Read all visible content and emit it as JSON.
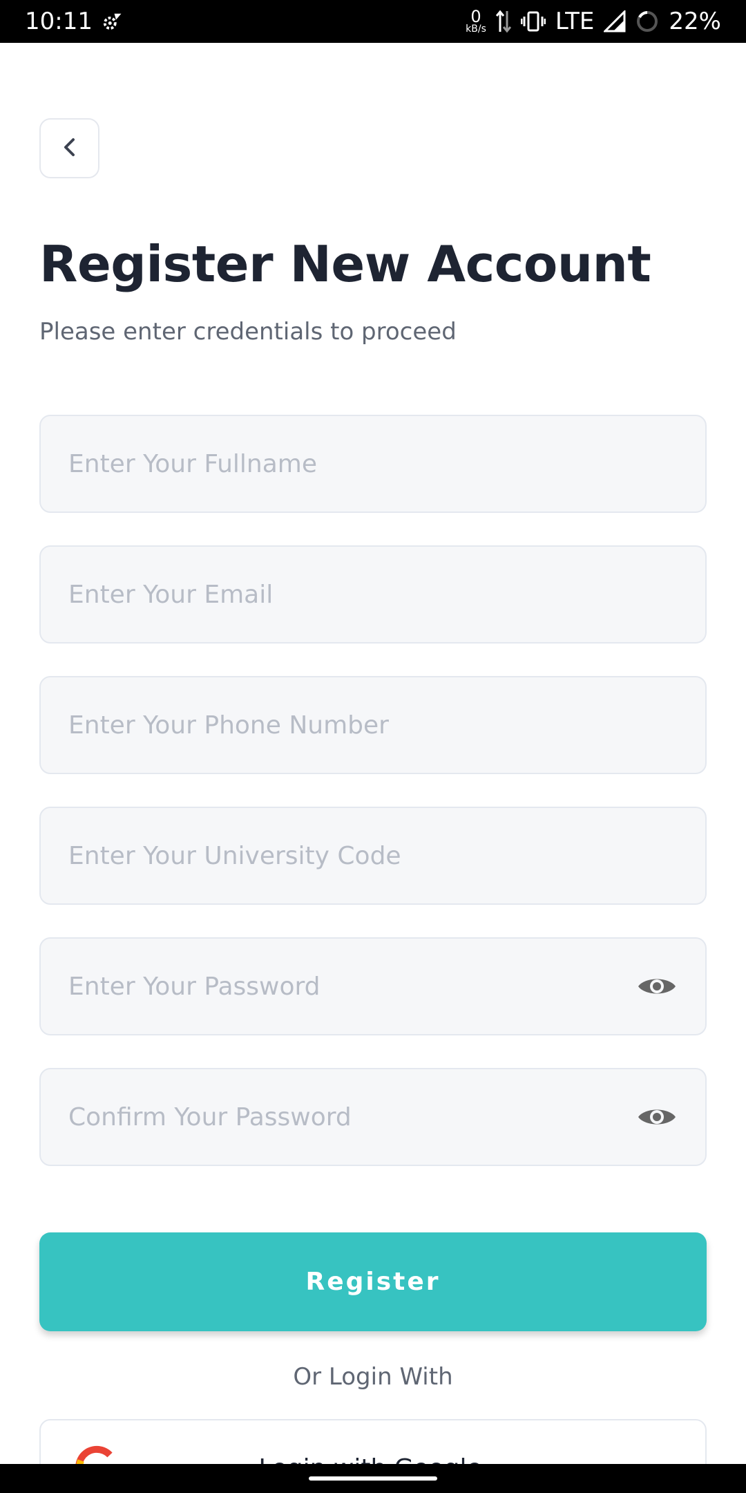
{
  "status_bar": {
    "time": "10:11",
    "data_rate_value": "0",
    "data_rate_unit": "kB/s",
    "network": "LTE",
    "battery": "22%"
  },
  "header": {
    "title": "Register New Account",
    "subtitle": "Please enter credentials to proceed"
  },
  "form": {
    "fullname_placeholder": "Enter Your Fullname",
    "email_placeholder": "Enter Your Email",
    "phone_placeholder": "Enter Your Phone Number",
    "university_placeholder": "Enter Your University Code",
    "password_placeholder": "Enter Your Password",
    "confirm_placeholder": "Confirm Your Password"
  },
  "actions": {
    "register_label": "Register",
    "or_login": "Or Login With",
    "google_label": "Login with Google"
  },
  "icons": {
    "back": "chevron-left-icon",
    "eye": "eye-icon",
    "google": "google-logo-icon"
  },
  "colors": {
    "accent": "#37c3c1",
    "title": "#1e2432",
    "field_bg": "#f6f7f9"
  }
}
